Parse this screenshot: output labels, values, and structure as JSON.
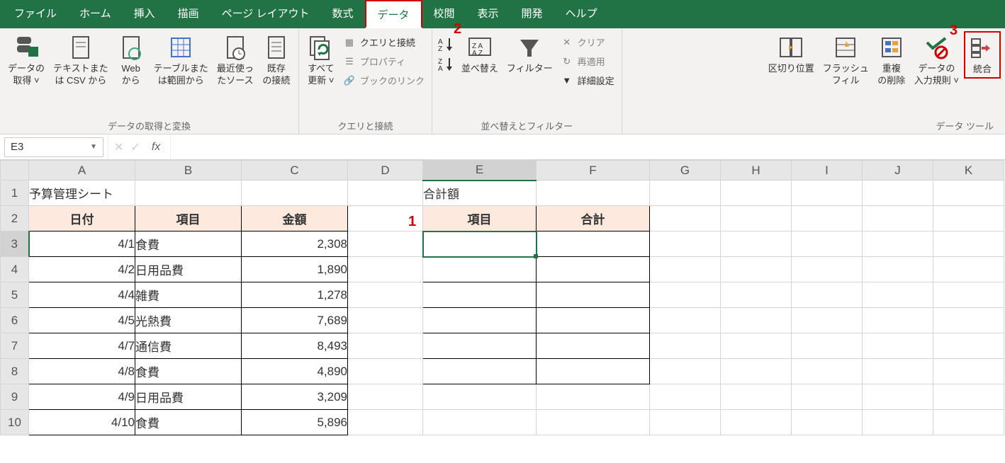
{
  "menu": {
    "file": "ファイル",
    "home": "ホーム",
    "insert": "挿入",
    "draw": "描画",
    "pagelayout": "ページ レイアウト",
    "formulas": "数式",
    "data": "データ",
    "review": "校閲",
    "view": "表示",
    "developer": "開発",
    "help": "ヘルプ"
  },
  "ribbon": {
    "group1": {
      "label": "データの取得と変換",
      "getdata": "データの\n取得 ˅",
      "csv": "テキストまた\nは CSV から",
      "web": "Web\nから",
      "table": "テーブルまた\nは範囲から",
      "recent": "最近使っ\nたソース",
      "existing": "既存\nの接続"
    },
    "group2": {
      "label": "クエリと接続",
      "refresh": "すべて\n更新 ˅",
      "queries": "クエリと接続",
      "props": "プロパティ",
      "links": "ブックのリンク"
    },
    "group3": {
      "label": "並べ替えとフィルター",
      "sort": "並べ替え",
      "filter": "フィルター",
      "clear": "クリア",
      "reapply": "再適用",
      "advanced": "詳細設定"
    },
    "group4": {
      "label": "データ ツール",
      "texttocolumns": "区切り位置",
      "flashfill": "フラッシュ\nフィル",
      "removedupes": "重複\nの削除",
      "validation": "データの\n入力規則 ˅",
      "consolidate": "統合"
    }
  },
  "formula_bar": {
    "namebox": "E3",
    "fx": "fx"
  },
  "annotations": {
    "a1": "1",
    "a2": "2",
    "a3": "3"
  },
  "sheet": {
    "columns": [
      "A",
      "B",
      "C",
      "D",
      "E",
      "F",
      "G",
      "H",
      "I",
      "J",
      "K"
    ],
    "rows": [
      "1",
      "2",
      "3",
      "4",
      "5",
      "6",
      "7",
      "8",
      "9",
      "10"
    ],
    "title": "予算管理シート",
    "sumtitle": "合計額",
    "hdr_date": "日付",
    "hdr_item": "項目",
    "hdr_amount": "金額",
    "hdr_item2": "項目",
    "hdr_sum": "合計",
    "data": [
      {
        "date": "4/1",
        "item": "食費",
        "amount": "2,308"
      },
      {
        "date": "4/2",
        "item": "日用品費",
        "amount": "1,890"
      },
      {
        "date": "4/4",
        "item": "雑費",
        "amount": "1,278"
      },
      {
        "date": "4/5",
        "item": "光熱費",
        "amount": "7,689"
      },
      {
        "date": "4/7",
        "item": "通信費",
        "amount": "8,493"
      },
      {
        "date": "4/8",
        "item": "食費",
        "amount": "4,890"
      },
      {
        "date": "4/9",
        "item": "日用品費",
        "amount": "3,209"
      },
      {
        "date": "4/10",
        "item": "食費",
        "amount": "5,896"
      }
    ]
  }
}
